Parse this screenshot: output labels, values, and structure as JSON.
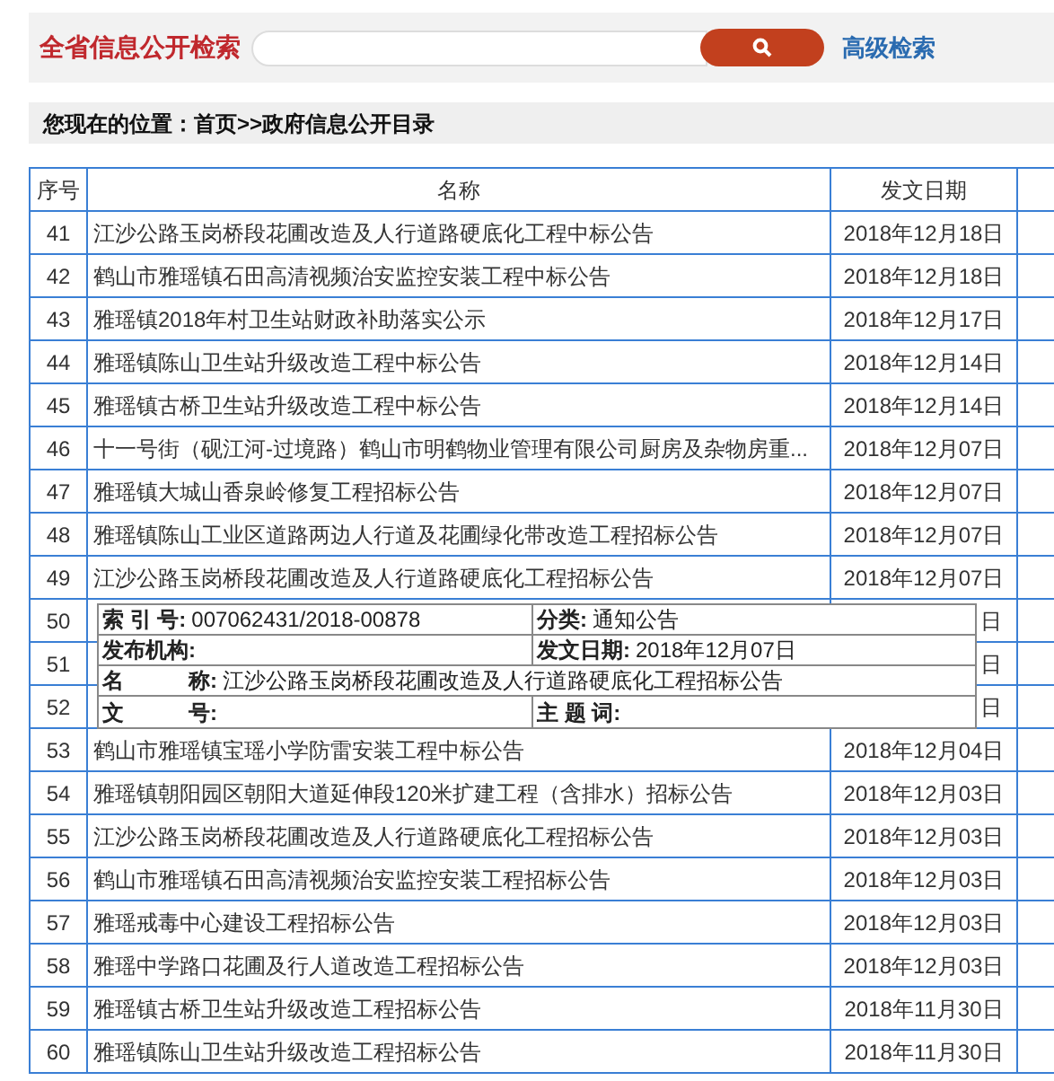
{
  "search": {
    "label": "全省信息公开检索",
    "advanced": "高级检索"
  },
  "breadcrumb": "您现在的位置：首页>>政府信息公开目录",
  "table": {
    "columns": [
      "序号",
      "名称",
      "发文日期"
    ],
    "rows": [
      {
        "no": "41",
        "name": "江沙公路玉岗桥段花圃改造及人行道路硬底化工程中标公告",
        "date": "2018年12月18日"
      },
      {
        "no": "42",
        "name": "鹤山市雅瑶镇石田高清视频治安监控安装工程中标公告",
        "date": "2018年12月18日"
      },
      {
        "no": "43",
        "name": "雅瑶镇2018年村卫生站财政补助落实公示",
        "date": "2018年12月17日"
      },
      {
        "no": "44",
        "name": "雅瑶镇陈山卫生站升级改造工程中标公告",
        "date": "2018年12月14日"
      },
      {
        "no": "45",
        "name": "雅瑶镇古桥卫生站升级改造工程中标公告",
        "date": "2018年12月14日"
      },
      {
        "no": "46",
        "name": "十一号街（砚江河-过境路）鹤山市明鹤物业管理有限公司厨房及杂物房重...",
        "date": "2018年12月07日"
      },
      {
        "no": "47",
        "name": "雅瑶镇大城山香泉岭修复工程招标公告",
        "date": "2018年12月07日"
      },
      {
        "no": "48",
        "name": "雅瑶镇陈山工业区道路两边人行道及花圃绿化带改造工程招标公告",
        "date": "2018年12月07日"
      },
      {
        "no": "49",
        "name": "江沙公路玉岗桥段花圃改造及人行道路硬底化工程招标公告",
        "date": "2018年12月07日"
      },
      {
        "no": "50",
        "date": "日"
      },
      {
        "no": "51",
        "date": "日"
      },
      {
        "no": "52",
        "date": "日"
      },
      {
        "no": "53",
        "name": "鹤山市雅瑶镇宝瑶小学防雷安装工程中标公告",
        "date": "2018年12月04日"
      },
      {
        "no": "54",
        "name": "雅瑶镇朝阳园区朝阳大道延伸段120米扩建工程（含排水）招标公告",
        "date": "2018年12月03日"
      },
      {
        "no": "55",
        "name": "江沙公路玉岗桥段花圃改造及人行道路硬底化工程招标公告",
        "date": "2018年12月03日"
      },
      {
        "no": "56",
        "name": "鹤山市雅瑶镇石田高清视频治安监控安装工程招标公告",
        "date": "2018年12月03日"
      },
      {
        "no": "57",
        "name": "雅瑶戒毒中心建设工程招标公告",
        "date": "2018年12月03日"
      },
      {
        "no": "58",
        "name": "雅瑶中学路口花圃及行人道改造工程招标公告",
        "date": "2018年12月03日"
      },
      {
        "no": "59",
        "name": "雅瑶镇古桥卫生站升级改造工程招标公告",
        "date": "2018年11月30日"
      },
      {
        "no": "60",
        "name": "雅瑶镇陈山卫生站升级改造工程招标公告",
        "date": "2018年11月30日"
      }
    ]
  },
  "tooltip": {
    "rows": [
      [
        {
          "label": "索 引 号:",
          "value": "007062431/2018-00878"
        },
        {
          "label": "分类:",
          "value": "通知公告"
        }
      ],
      [
        {
          "label": "发布机构:"
        },
        {
          "label": "发文日期:",
          "value": "2018年12月07日"
        }
      ],
      [
        {
          "label": "名　　　称:",
          "value": "江沙公路玉岗桥段花圃改造及人行道路硬底化工程招标公告"
        }
      ],
      [
        {
          "label": "文　　　号:"
        },
        {
          "label": "主 题 词:"
        }
      ]
    ]
  }
}
